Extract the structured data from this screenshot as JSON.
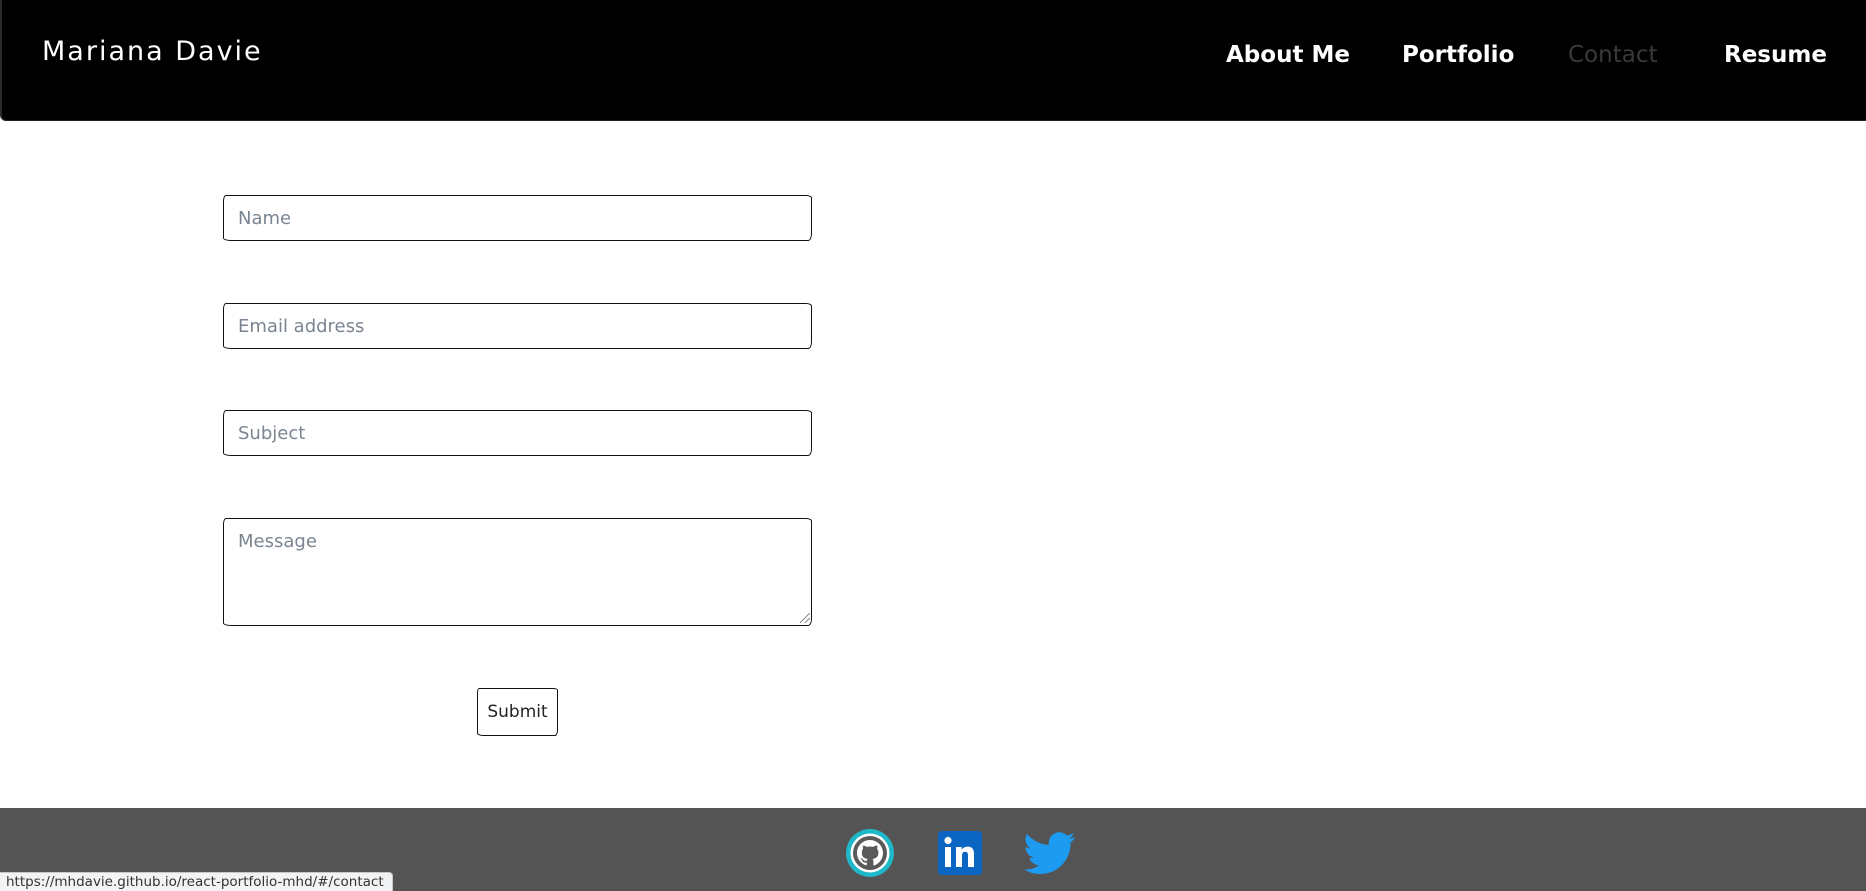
{
  "header": {
    "brand": "Mariana Davie",
    "nav": [
      {
        "label": "About Me",
        "active": false
      },
      {
        "label": "Portfolio",
        "active": false
      },
      {
        "label": "Contact",
        "active": true
      },
      {
        "label": "Resume",
        "active": false
      }
    ]
  },
  "form": {
    "name_placeholder": "Name",
    "name_value": "",
    "email_placeholder": "Email address",
    "email_value": "",
    "subject_placeholder": "Subject",
    "subject_value": "",
    "message_placeholder": "Message",
    "message_value": "",
    "submit_label": "Submit"
  },
  "footer": {
    "links": [
      {
        "icon": "github-icon",
        "color": "#1fb8c8"
      },
      {
        "icon": "linkedin-icon",
        "color": "#0a66c2"
      },
      {
        "icon": "twitter-icon",
        "color": "#1d9bf0"
      }
    ]
  },
  "status_bar": {
    "url": "https://mhdavie.github.io/react-portfolio-mhd/#/contact"
  },
  "colors": {
    "navbar_bg": "#000000",
    "footer_bg": "#545454",
    "active_nav": "#3a3a3a"
  }
}
